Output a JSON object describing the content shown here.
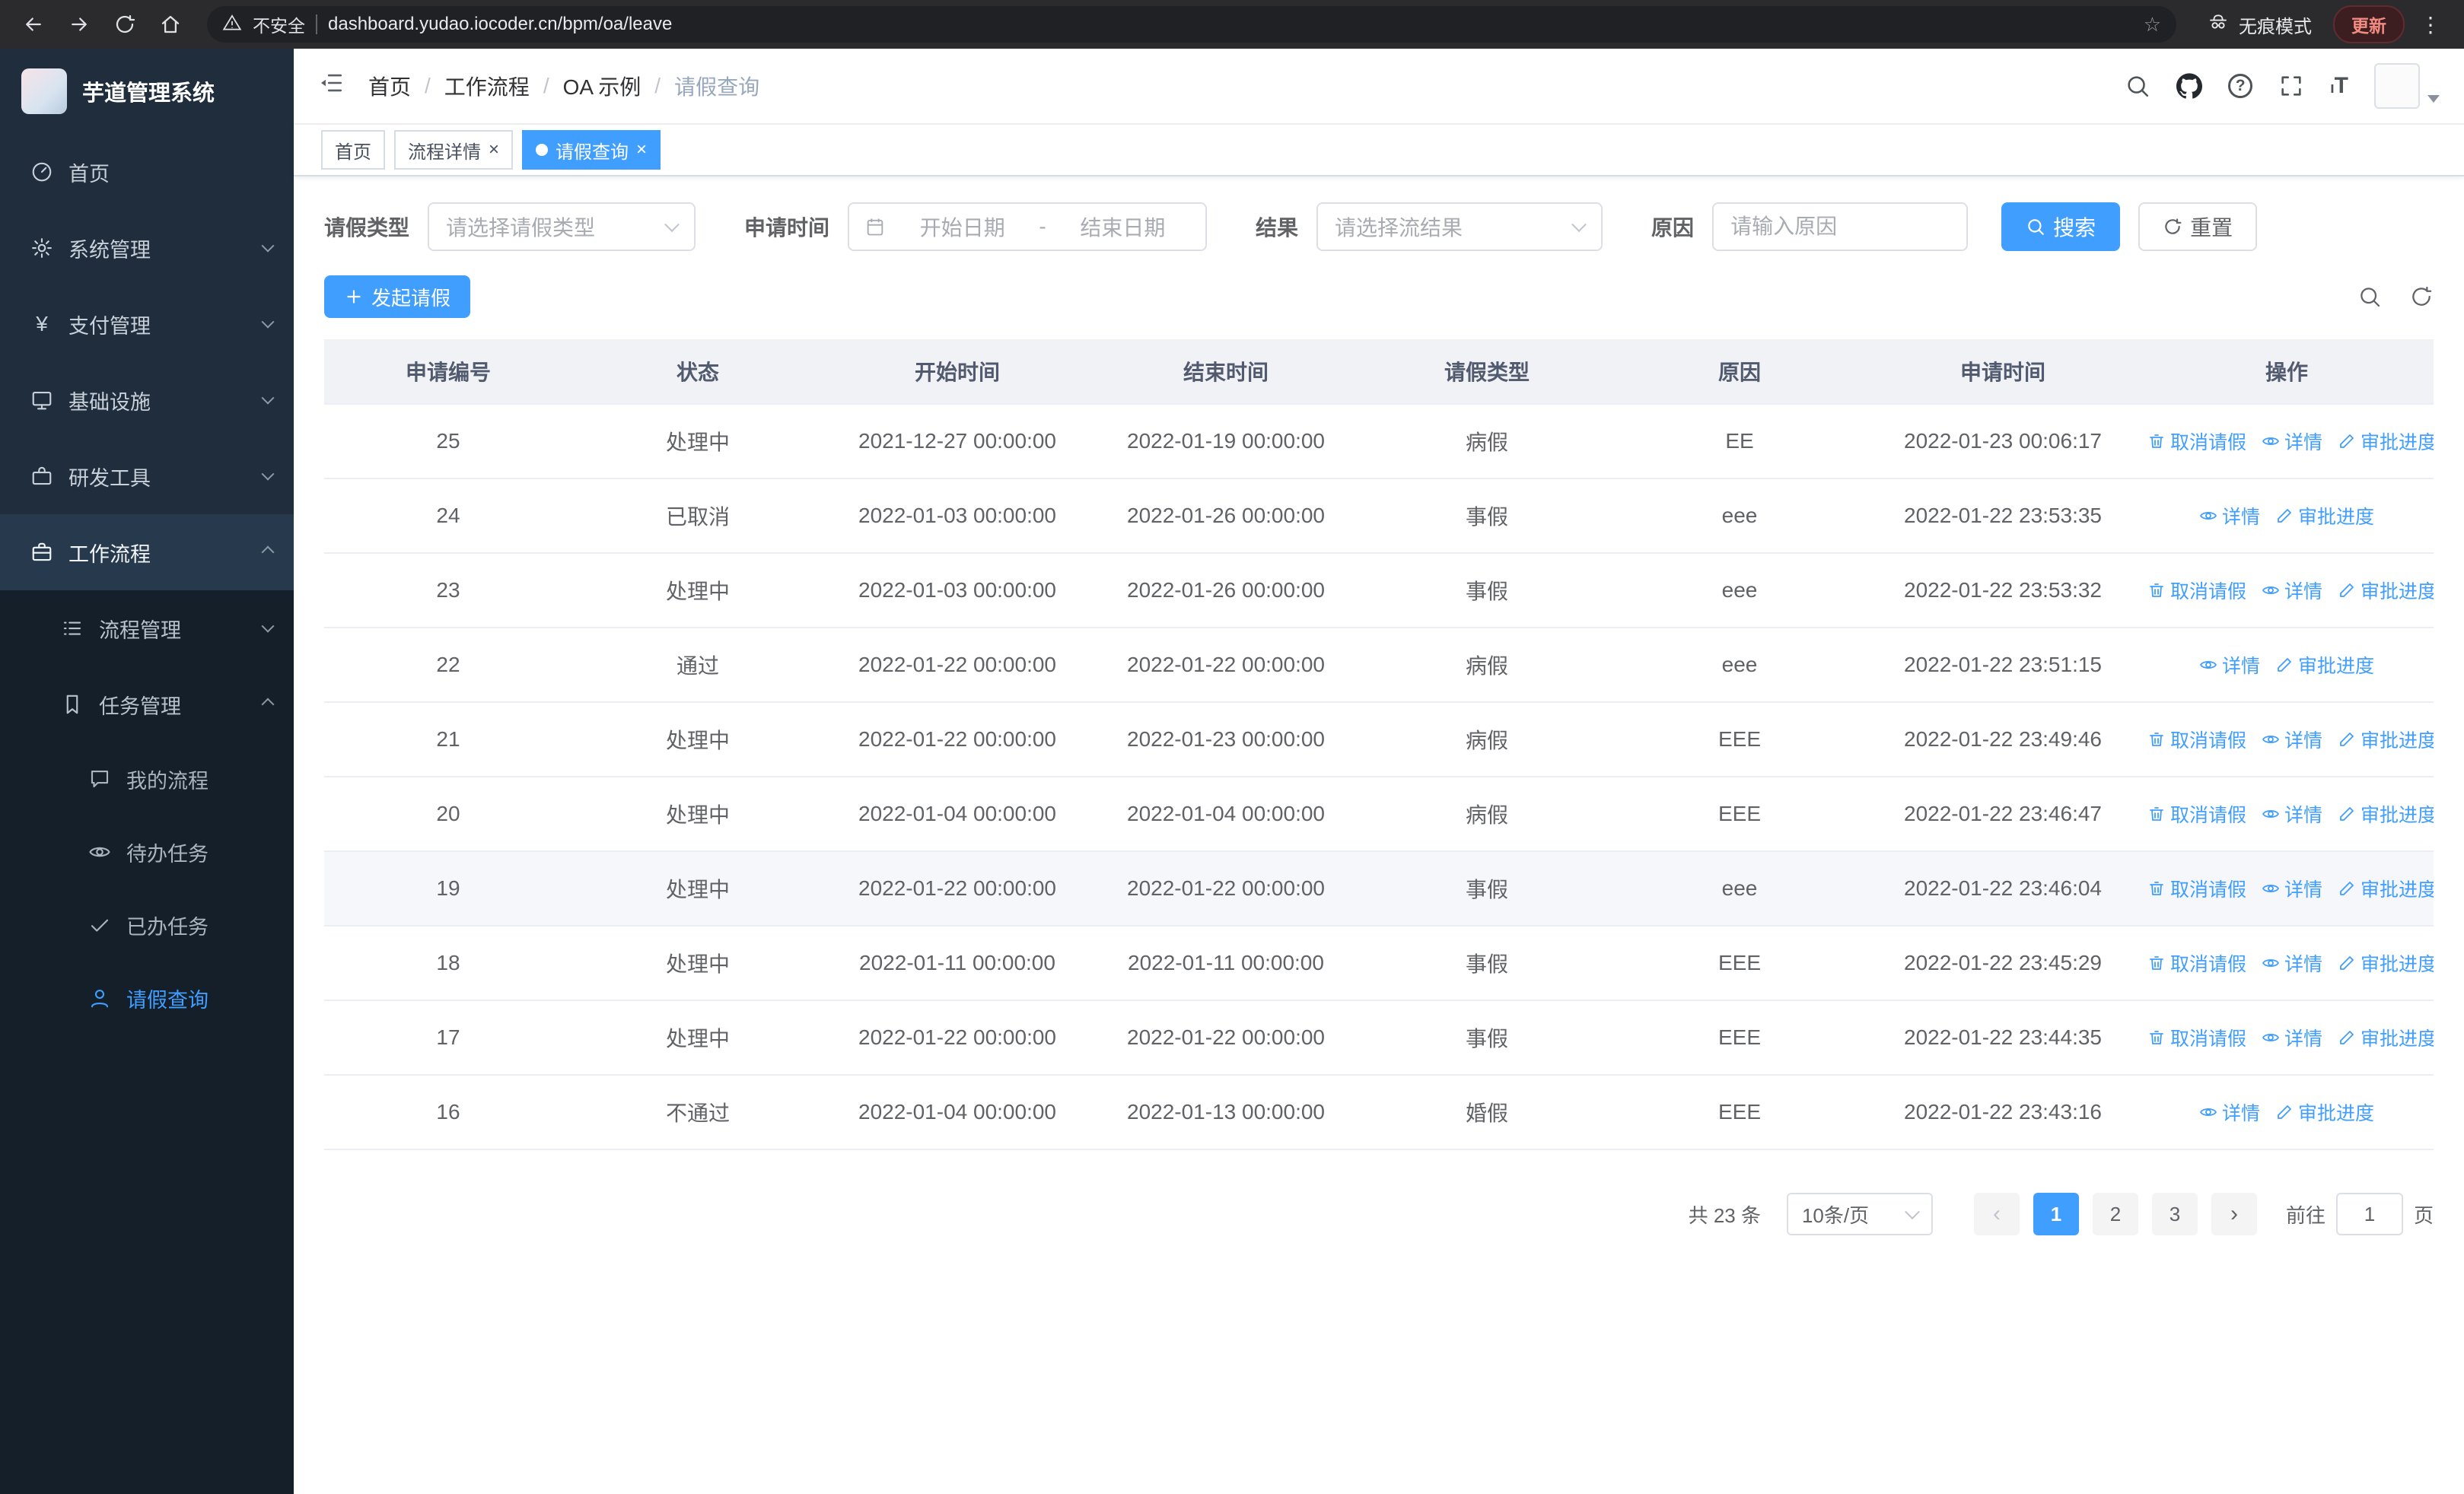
{
  "browser": {
    "security_label": "不安全",
    "url": "dashboard.yudao.iocoder.cn/bpm/oa/leave",
    "incognito_label": "无痕模式",
    "update_label": "更新"
  },
  "sidebar": {
    "title": "芋道管理系统",
    "items": [
      {
        "label": "首页",
        "icon": "dashboard-icon"
      },
      {
        "label": "系统管理",
        "icon": "gear-icon"
      },
      {
        "label": "支付管理",
        "icon": "yen-icon"
      },
      {
        "label": "基础设施",
        "icon": "monitor-icon"
      },
      {
        "label": "研发工具",
        "icon": "toolbox-icon"
      },
      {
        "label": "工作流程",
        "icon": "briefcase-icon"
      }
    ],
    "sub_items": [
      {
        "label": "流程管理",
        "icon": "list-icon"
      },
      {
        "label": "任务管理",
        "icon": "bookmark-icon"
      }
    ],
    "leaf_items": [
      {
        "label": "我的流程",
        "icon": "chat-icon"
      },
      {
        "label": "待办任务",
        "icon": "eye-icon"
      },
      {
        "label": "已办任务",
        "icon": "check-icon"
      },
      {
        "label": "请假查询",
        "icon": "user-icon"
      }
    ]
  },
  "breadcrumb": [
    "首页",
    "工作流程",
    "OA 示例",
    "请假查询"
  ],
  "tabs": [
    {
      "label": "首页"
    },
    {
      "label": "流程详情"
    },
    {
      "label": "请假查询"
    }
  ],
  "filters": {
    "type_label": "请假类型",
    "type_placeholder": "请选择请假类型",
    "time_label": "申请时间",
    "time_start_placeholder": "开始日期",
    "time_separator": "-",
    "time_end_placeholder": "结束日期",
    "result_label": "结果",
    "result_placeholder": "请选择流结果",
    "reason_label": "原因",
    "reason_placeholder": "请输入原因",
    "search_label": "搜索",
    "reset_label": "重置"
  },
  "toolbar": {
    "create_label": "发起请假"
  },
  "table": {
    "columns": [
      "申请编号",
      "状态",
      "开始时间",
      "结束时间",
      "请假类型",
      "原因",
      "申请时间",
      "操作"
    ],
    "action_labels": {
      "cancel": "取消请假",
      "detail": "详情",
      "progress": "审批进度"
    },
    "rows": [
      {
        "id": "25",
        "status": "处理中",
        "start": "2021-12-27 00:00:00",
        "end": "2022-01-19 00:00:00",
        "type": "病假",
        "reason": "EE",
        "applied": "2022-01-23 00:06:17",
        "actions": [
          "cancel",
          "detail",
          "progress"
        ]
      },
      {
        "id": "24",
        "status": "已取消",
        "start": "2022-01-03 00:00:00",
        "end": "2022-01-26 00:00:00",
        "type": "事假",
        "reason": "eee",
        "applied": "2022-01-22 23:53:35",
        "actions": [
          "detail",
          "progress"
        ]
      },
      {
        "id": "23",
        "status": "处理中",
        "start": "2022-01-03 00:00:00",
        "end": "2022-01-26 00:00:00",
        "type": "事假",
        "reason": "eee",
        "applied": "2022-01-22 23:53:32",
        "actions": [
          "cancel",
          "detail",
          "progress"
        ]
      },
      {
        "id": "22",
        "status": "通过",
        "start": "2022-01-22 00:00:00",
        "end": "2022-01-22 00:00:00",
        "type": "病假",
        "reason": "eee",
        "applied": "2022-01-22 23:51:15",
        "actions": [
          "detail",
          "progress"
        ]
      },
      {
        "id": "21",
        "status": "处理中",
        "start": "2022-01-22 00:00:00",
        "end": "2022-01-23 00:00:00",
        "type": "病假",
        "reason": "EEE",
        "applied": "2022-01-22 23:49:46",
        "actions": [
          "cancel",
          "detail",
          "progress"
        ]
      },
      {
        "id": "20",
        "status": "处理中",
        "start": "2022-01-04 00:00:00",
        "end": "2022-01-04 00:00:00",
        "type": "病假",
        "reason": "EEE",
        "applied": "2022-01-22 23:46:47",
        "actions": [
          "cancel",
          "detail",
          "progress"
        ]
      },
      {
        "id": "19",
        "status": "处理中",
        "start": "2022-01-22 00:00:00",
        "end": "2022-01-22 00:00:00",
        "type": "事假",
        "reason": "eee",
        "applied": "2022-01-22 23:46:04",
        "actions": [
          "cancel",
          "detail",
          "progress"
        ],
        "highlighted": true
      },
      {
        "id": "18",
        "status": "处理中",
        "start": "2022-01-11 00:00:00",
        "end": "2022-01-11 00:00:00",
        "type": "事假",
        "reason": "EEE",
        "applied": "2022-01-22 23:45:29",
        "actions": [
          "cancel",
          "detail",
          "progress"
        ]
      },
      {
        "id": "17",
        "status": "处理中",
        "start": "2022-01-22 00:00:00",
        "end": "2022-01-22 00:00:00",
        "type": "事假",
        "reason": "EEE",
        "applied": "2022-01-22 23:44:35",
        "actions": [
          "cancel",
          "detail",
          "progress"
        ]
      },
      {
        "id": "16",
        "status": "不通过",
        "start": "2022-01-04 00:00:00",
        "end": "2022-01-13 00:00:00",
        "type": "婚假",
        "reason": "EEE",
        "applied": "2022-01-22 23:43:16",
        "actions": [
          "detail",
          "progress"
        ]
      }
    ]
  },
  "pagination": {
    "total_label": "共 23 条",
    "page_size": "10条/页",
    "prev": "‹",
    "next": "›",
    "pages": [
      "1",
      "2",
      "3"
    ],
    "active_page": "1",
    "goto_label": "前往",
    "goto_value": "1",
    "goto_unit": "页"
  },
  "icons": {
    "chrome": [
      "back-icon",
      "forward-icon",
      "refresh-icon",
      "home-icon",
      "warning-icon",
      "bookmark-star-icon",
      "incognito-icon",
      "kebab-menu-icon"
    ],
    "sidebar": [
      "dashboard-icon",
      "gear-icon",
      "yen-icon",
      "monitor-icon",
      "toolbox-icon",
      "briefcase-icon",
      "list-icon",
      "bookmark-icon",
      "chat-icon",
      "eye-icon",
      "check-icon",
      "user-icon"
    ],
    "header": [
      "menu-fold-icon",
      "search-icon",
      "github-icon",
      "help-icon",
      "fullscreen-icon",
      "font-size-icon"
    ],
    "actions": [
      "trash-icon",
      "eye-icon",
      "pen-icon"
    ]
  }
}
